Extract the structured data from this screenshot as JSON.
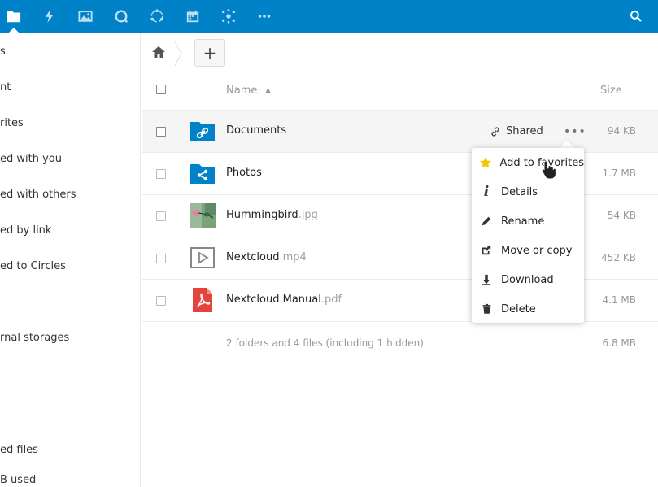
{
  "colors": {
    "header_bg": "#0082c9",
    "folder_blue": "#0082c9",
    "star": "#f4c600",
    "pdf_red": "#e4443b"
  },
  "header": {
    "apps": [
      {
        "name": "files",
        "icon": "folder-icon",
        "active": true
      },
      {
        "name": "activity",
        "icon": "lightning-icon"
      },
      {
        "name": "gallery",
        "icon": "image-icon"
      },
      {
        "name": "talk",
        "icon": "talk-icon"
      },
      {
        "name": "circles",
        "icon": "circles-icon"
      },
      {
        "name": "calendar",
        "icon": "calendar-icon"
      },
      {
        "name": "cospend",
        "icon": "network-icon"
      },
      {
        "name": "more",
        "icon": "more-icon"
      }
    ],
    "search_icon": "search-icon"
  },
  "sidebar": {
    "items": [
      {
        "label": "s"
      },
      {
        "label": "nt"
      },
      {
        "label": "rites"
      },
      {
        "label": "ed with you"
      },
      {
        "label": "ed with others"
      },
      {
        "label": "ed by link"
      },
      {
        "label": "ed to Circles"
      },
      {
        "label": "rnal storages"
      }
    ],
    "footer": [
      {
        "label": "ed files"
      },
      {
        "label": "B used"
      }
    ]
  },
  "breadcrumb": {
    "home_icon": "home-icon",
    "new_label": "+"
  },
  "table": {
    "columns": {
      "name": "Name",
      "size": "Size"
    },
    "rows": [
      {
        "name": "Documents",
        "ext": "",
        "size": "94 KB",
        "icon": "folder-link-icon",
        "shared": "Shared"
      },
      {
        "name": "Photos",
        "ext": "",
        "size": "1.7 MB",
        "icon": "folder-shared-icon"
      },
      {
        "name": "Hummingbird",
        "ext": ".jpg",
        "size": "54 KB",
        "icon": "image-thumbnail"
      },
      {
        "name": "Nextcloud",
        "ext": ".mp4",
        "size": "452 KB",
        "icon": "video-icon"
      },
      {
        "name": "Nextcloud Manual",
        "ext": ".pdf",
        "size": "4.1 MB",
        "icon": "pdf-icon"
      }
    ],
    "summary": {
      "text": "2 folders and 4 files (including 1 hidden)",
      "size": "6.8 MB"
    },
    "more_label": "•••"
  },
  "menu": {
    "items": [
      {
        "label": "Add to favorites",
        "icon": "star-icon"
      },
      {
        "label": "Details",
        "icon": "info-icon"
      },
      {
        "label": "Rename",
        "icon": "pencil-icon"
      },
      {
        "label": "Move or copy",
        "icon": "external-icon"
      },
      {
        "label": "Download",
        "icon": "download-icon"
      },
      {
        "label": "Delete",
        "icon": "trash-icon"
      }
    ]
  }
}
